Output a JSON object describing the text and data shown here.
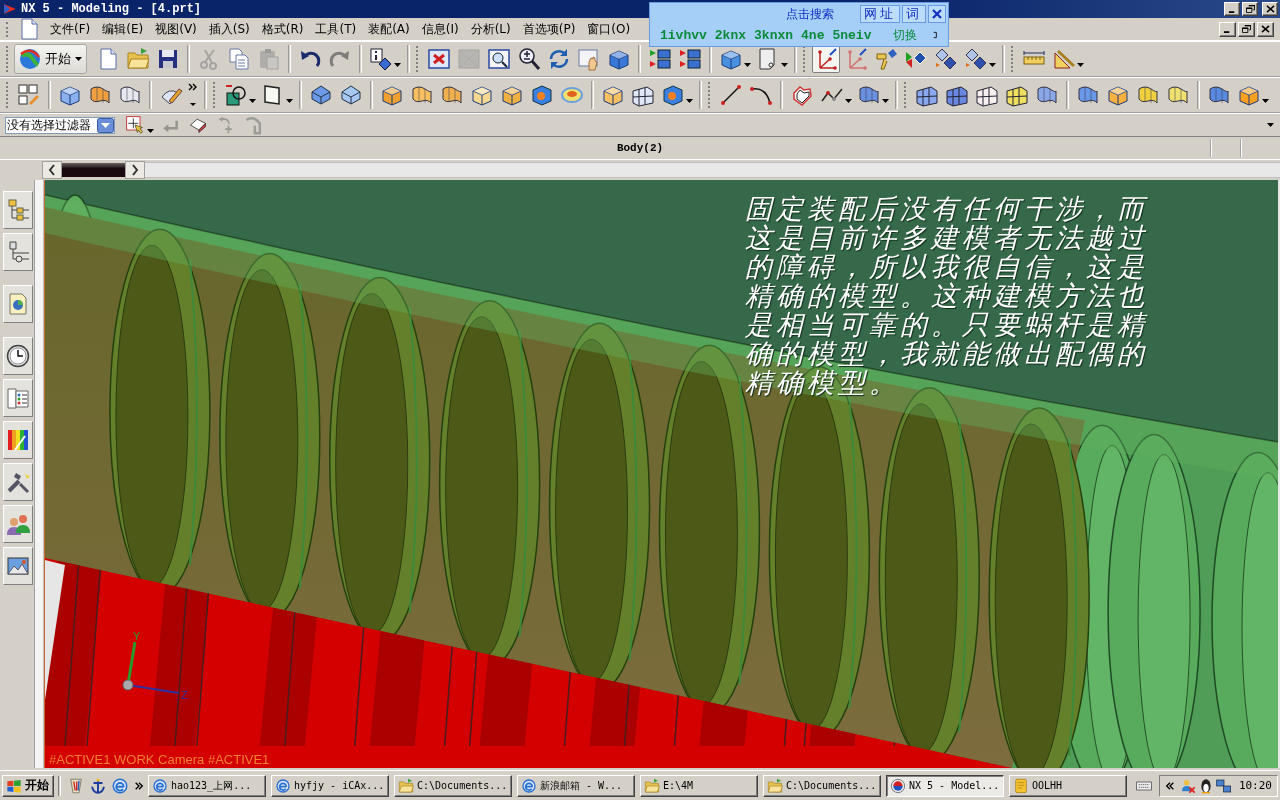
{
  "window": {
    "title": "NX 5 - Modeling - [4.prt]"
  },
  "menu_bar": {
    "items": [
      "文件(F)",
      "编辑(E)",
      "视图(V)",
      "插入(S)",
      "格式(R)",
      "工具(T)",
      "装配(A)",
      "信息(I)",
      "分析(L)",
      "首选项(P)",
      "窗口(O)"
    ]
  },
  "search_popup": {
    "title": "点击搜索",
    "buttons": [
      "网址",
      "词"
    ],
    "links": [
      "1ivhvv",
      "2knx",
      "3knxn",
      "4ne",
      "5neiv"
    ],
    "switch": "切换"
  },
  "toolbar": {
    "start_button": "开始",
    "buttons": [
      {
        "disabled": false,
        "pressed": false
      },
      {
        "disabled": false,
        "pressed": false
      },
      {
        "disabled": false,
        "pressed": false
      },
      {
        "disabled": true,
        "pressed": false
      },
      {
        "disabled": false,
        "pressed": false
      },
      {
        "disabled": true,
        "pressed": false
      },
      {
        "disabled": false,
        "pressed": false
      },
      {
        "disabled": true,
        "pressed": false
      },
      {
        "disabled": false,
        "pressed": false
      },
      {
        "disabled": false,
        "pressed": false
      },
      {
        "disabled": true,
        "pressed": false
      },
      {
        "disabled": false,
        "pressed": false
      },
      {
        "disabled": false,
        "pressed": false
      },
      {
        "disabled": false,
        "pressed": false
      },
      {
        "disabled": false,
        "pressed": false
      },
      {
        "disabled": false,
        "pressed": false
      },
      {
        "disabled": false,
        "pressed": false
      },
      {
        "disabled": false,
        "pressed": false
      },
      {
        "disabled": false,
        "pressed": false
      },
      {
        "disabled": false,
        "pressed": false
      },
      {
        "disabled": false,
        "pressed": true
      },
      {
        "disabled": false,
        "pressed": false
      },
      {
        "disabled": false,
        "pressed": false
      },
      {
        "disabled": false,
        "pressed": false
      },
      {
        "disabled": false,
        "pressed": false
      },
      {
        "disabled": false,
        "pressed": false
      },
      {
        "disabled": false,
        "pressed": false
      },
      {
        "disabled": false,
        "pressed": false
      }
    ]
  },
  "selection_bar": {
    "filter": "没有选择过滤器",
    "tools": [
      {
        "disabled": false
      },
      {
        "disabled": true
      },
      {
        "disabled": false
      },
      {
        "disabled": true
      },
      {
        "disabled": true
      }
    ]
  },
  "cue_line": {
    "text": "Body(2)"
  },
  "graphics_window": {
    "annotation": "固定装配后没有任何干涉，而这是目前许多建模者无法越过的障碍，所以我很自信，这是精确的模型。这种建模方法也是相当可靠的。只要蜗杆是精确的模型，我就能做出配偶的精确模型。",
    "axis_labels": [
      "Y",
      "Z"
    ],
    "view_label": "#ACTIVE1 WORK Camera #ACTIVE1"
  },
  "taskbar": {
    "start_button": "开始",
    "tasks": [
      {
        "label": "hao123_上网...",
        "selected": false
      },
      {
        "label": "hyfjy - iCAx...",
        "selected": false
      },
      {
        "label": "C:\\Documents...",
        "selected": false
      },
      {
        "label": "新浪邮箱 - W...",
        "selected": false
      },
      {
        "label": "E:\\4M",
        "selected": false
      },
      {
        "label": "C:\\Documents...",
        "selected": false
      },
      {
        "label": "NX 5 - Model...",
        "selected": true
      },
      {
        "label": "OOLHH",
        "selected": false
      }
    ],
    "clock": "10:20"
  }
}
